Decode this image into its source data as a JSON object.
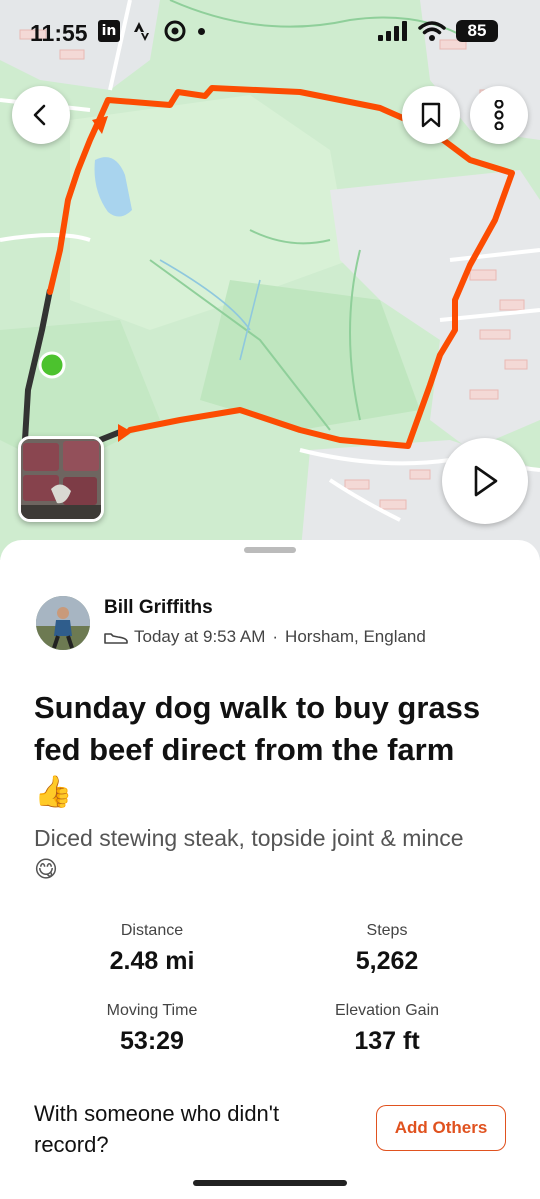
{
  "status_bar": {
    "time": "11:55",
    "linkedin": "in",
    "battery": "85"
  },
  "colors": {
    "route": "#fc4c02",
    "map_green": "#cfeccf",
    "accent": "#e0521f"
  },
  "icons": {
    "back": "chevron-left-icon",
    "bookmark": "bookmark-icon",
    "more": "more-vertical-icon",
    "play": "play-icon",
    "shoe": "shoe-icon"
  },
  "activity": {
    "athlete": "Bill Griffiths",
    "when": "Today at 9:53 AM",
    "location": "Horsham, England",
    "title": "Sunday dog walk to buy grass fed beef direct from the farm",
    "title_emoji": "👍",
    "description": "Diced stewing steak, topside joint & mince",
    "description_emoji": "😋"
  },
  "stats": {
    "distance_label": "Distance",
    "distance_value": "2.48 mi",
    "steps_label": "Steps",
    "steps_value": "5,262",
    "time_label": "Moving Time",
    "time_value": "53:29",
    "elev_label": "Elevation Gain",
    "elev_value": "137 ft"
  },
  "footer": {
    "question": "With someone who didn't record?",
    "add_label": "Add Others"
  }
}
